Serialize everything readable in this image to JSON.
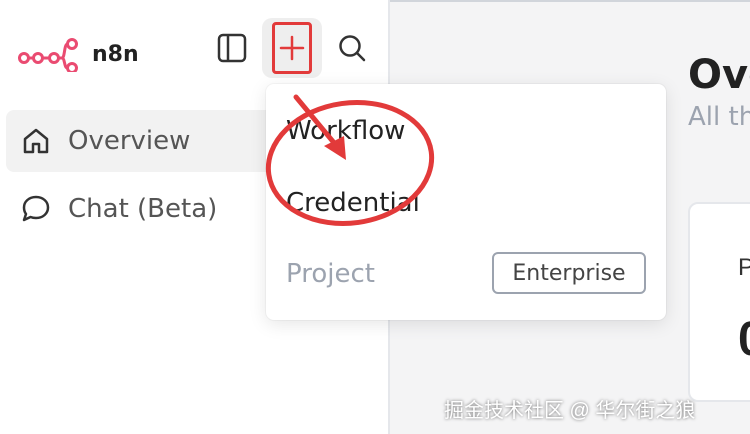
{
  "app": {
    "name": "n8n"
  },
  "toolbar": {
    "panel_icon": "sidebar-panel-icon",
    "add_icon": "plus-icon",
    "search_icon": "search-icon"
  },
  "sidebar": {
    "items": [
      {
        "label": "Overview",
        "icon": "home-icon",
        "active": true
      },
      {
        "label": "Chat (Beta)",
        "icon": "chat-bubble-icon",
        "active": false
      }
    ]
  },
  "create_menu": {
    "items": [
      {
        "label": "Workflow"
      },
      {
        "label": "Credential"
      },
      {
        "label": "Project",
        "badge": "Enterprise",
        "disabled": true
      }
    ]
  },
  "main": {
    "title": "Ove",
    "subtitle": "All th",
    "card": {
      "label": "P",
      "value": "0"
    }
  },
  "watermark": "掘金技术社区 @ 华尔街之狼",
  "colors": {
    "brand": "#ea4b71",
    "highlight": "#e23a3a",
    "active_bg": "#f2f2f2"
  }
}
